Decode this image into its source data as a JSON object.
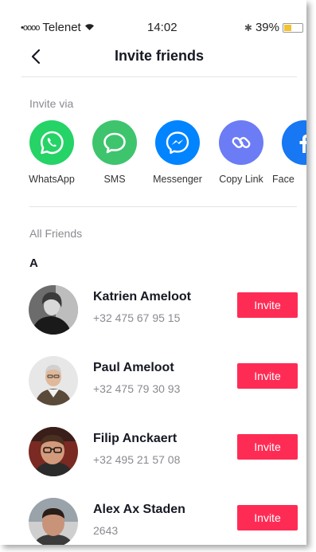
{
  "status_bar": {
    "signal": "•oooo",
    "carrier": "Telenet",
    "time": "14:02",
    "battery": "39%"
  },
  "header": {
    "title": "Invite friends"
  },
  "invite_via": {
    "label": "Invite via",
    "options": [
      {
        "label": "WhatsApp",
        "icon": "whatsapp-icon",
        "color": "#25d366"
      },
      {
        "label": "SMS",
        "icon": "sms-icon",
        "color": "#3ec46d"
      },
      {
        "label": "Messenger",
        "icon": "messenger-icon",
        "color": "#0084ff"
      },
      {
        "label": "Copy Link",
        "icon": "link-icon",
        "color": "#6b7cf5"
      },
      {
        "label": "Face",
        "icon": "facebook-icon",
        "color": "#1877f2"
      }
    ]
  },
  "all_friends": {
    "label": "All Friends",
    "sections": [
      {
        "letter": "A",
        "contacts": [
          {
            "name": "Katrien Ameloot",
            "phone": "+32 475 67 95 15",
            "invite_label": "Invite"
          },
          {
            "name": "Paul Ameloot",
            "phone": "+32 475 79 30 93",
            "invite_label": "Invite"
          },
          {
            "name": "Filip Anckaert",
            "phone": "+32 495 21 57 08",
            "invite_label": "Invite"
          },
          {
            "name": "Alex Ax Staden",
            "phone": "2643",
            "invite_label": "Invite"
          }
        ]
      }
    ]
  },
  "colors": {
    "accent": "#fe2c55",
    "secondary_text": "#8a8b91",
    "divider": "#e3e3e4"
  }
}
